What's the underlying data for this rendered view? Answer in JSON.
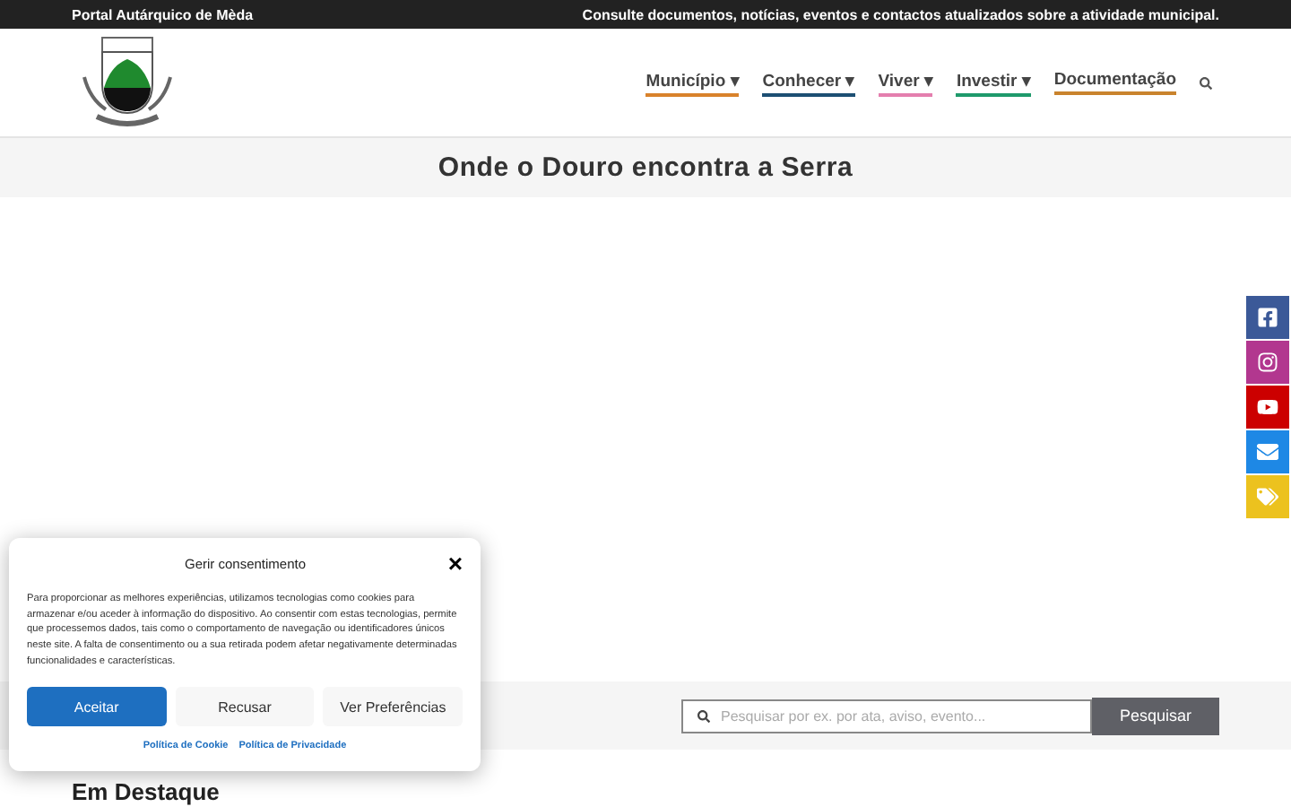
{
  "top_bar": {
    "site_name": "Portal Autárquico de Mèda",
    "tagline": "Consulte documentos, notícias, eventos e contactos atualizados sobre a atividade municipal."
  },
  "nav": {
    "items": [
      {
        "label": "Município ▾",
        "color": "#d9822b"
      },
      {
        "label": "Conhecer ▾",
        "color": "#1d4f73"
      },
      {
        "label": "Viver ▾",
        "color": "#e47fae"
      },
      {
        "label": "Investir ▾",
        "color": "#1f9a6b"
      },
      {
        "label": "Documentação",
        "color": "#c9832d"
      }
    ]
  },
  "hero": {
    "title": "Onde o Douro encontra a Serra"
  },
  "search": {
    "placeholder": "Pesquisar por ex. por ata, aviso, evento...",
    "button": "Pesquisar"
  },
  "section_heading": "Em Destaque",
  "social": [
    {
      "kind": "facebook",
      "color": "#3b5998"
    },
    {
      "kind": "instagram",
      "color": "#b2378f"
    },
    {
      "kind": "youtube",
      "color": "#cc0000"
    },
    {
      "kind": "email",
      "color": "#1e88e5"
    },
    {
      "kind": "tags",
      "color": "#ecc21e"
    }
  ],
  "consent": {
    "title": "Gerir consentimento",
    "close": "×",
    "body": "Para proporcionar as melhores experiências, utilizamos tecnologias como cookies para armazenar e/ou aceder à informação do dispositivo. Ao consentir com estas tecnologias, permite que processemos dados, tais como o comportamento de navegação ou identificadores únicos neste site. A falta de consentimento ou a sua retirada podem afetar negativamente determinadas funcionalidades e características.",
    "buttons": [
      {
        "label": "Aceitar",
        "kind": "primary"
      },
      {
        "label": "Recusar",
        "kind": "secondary"
      },
      {
        "label": "Ver Preferências",
        "kind": "secondary"
      }
    ],
    "links": [
      "Política de Cookie",
      "Política de Privacidade"
    ]
  }
}
